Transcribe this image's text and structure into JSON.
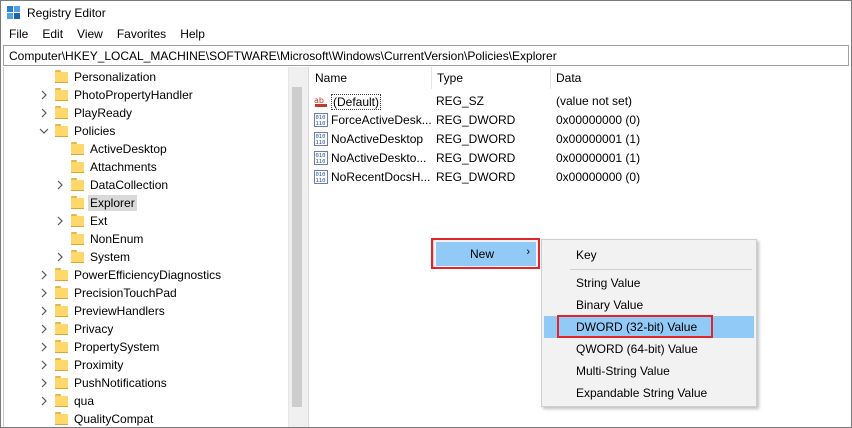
{
  "window": {
    "title": "Registry Editor"
  },
  "menu": [
    "File",
    "Edit",
    "View",
    "Favorites",
    "Help"
  ],
  "address": "Computer\\HKEY_LOCAL_MACHINE\\SOFTWARE\\Microsoft\\Windows\\CurrentVersion\\Policies\\Explorer",
  "tree": {
    "items": [
      {
        "label": "Personalization",
        "level": 1,
        "expander": "none",
        "selected": false
      },
      {
        "label": "PhotoPropertyHandler",
        "level": 1,
        "expander": "collapsed",
        "selected": false
      },
      {
        "label": "PlayReady",
        "level": 1,
        "expander": "collapsed",
        "selected": false
      },
      {
        "label": "Policies",
        "level": 1,
        "expander": "expanded",
        "selected": false
      },
      {
        "label": "ActiveDesktop",
        "level": 2,
        "expander": "none",
        "selected": false
      },
      {
        "label": "Attachments",
        "level": 2,
        "expander": "none",
        "selected": false
      },
      {
        "label": "DataCollection",
        "level": 2,
        "expander": "collapsed",
        "selected": false
      },
      {
        "label": "Explorer",
        "level": 2,
        "expander": "none",
        "selected": true
      },
      {
        "label": "Ext",
        "level": 2,
        "expander": "collapsed",
        "selected": false
      },
      {
        "label": "NonEnum",
        "level": 2,
        "expander": "none",
        "selected": false
      },
      {
        "label": "System",
        "level": 2,
        "expander": "collapsed",
        "selected": false
      },
      {
        "label": "PowerEfficiencyDiagnostics",
        "level": 1,
        "expander": "collapsed",
        "selected": false
      },
      {
        "label": "PrecisionTouchPad",
        "level": 1,
        "expander": "collapsed",
        "selected": false
      },
      {
        "label": "PreviewHandlers",
        "level": 1,
        "expander": "collapsed",
        "selected": false
      },
      {
        "label": "Privacy",
        "level": 1,
        "expander": "collapsed",
        "selected": false
      },
      {
        "label": "PropertySystem",
        "level": 1,
        "expander": "collapsed",
        "selected": false
      },
      {
        "label": "Proximity",
        "level": 1,
        "expander": "collapsed",
        "selected": false
      },
      {
        "label": "PushNotifications",
        "level": 1,
        "expander": "collapsed",
        "selected": false
      },
      {
        "label": "qua",
        "level": 1,
        "expander": "collapsed",
        "selected": false
      },
      {
        "label": "QualityCompat",
        "level": 1,
        "expander": "none",
        "selected": false
      }
    ]
  },
  "values": {
    "headers": {
      "name": "Name",
      "type": "Type",
      "data": "Data"
    },
    "rows": [
      {
        "name": "(Default)",
        "type": "REG_SZ",
        "data": "(value not set)",
        "icon": "string-value-icon"
      },
      {
        "name": "ForceActiveDesk...",
        "type": "REG_DWORD",
        "data": "0x00000000 (0)",
        "icon": "binary-value-icon"
      },
      {
        "name": "NoActiveDesktop",
        "type": "REG_DWORD",
        "data": "0x00000001 (1)",
        "icon": "binary-value-icon"
      },
      {
        "name": "NoActiveDeskto...",
        "type": "REG_DWORD",
        "data": "0x00000001 (1)",
        "icon": "binary-value-icon"
      },
      {
        "name": "NoRecentDocsH...",
        "type": "REG_DWORD",
        "data": "0x00000000 (0)",
        "icon": "binary-value-icon"
      }
    ]
  },
  "context_menu": {
    "new_label": "New",
    "submenu": [
      "Key",
      "String Value",
      "Binary Value",
      "DWORD (32-bit) Value",
      "QWORD (64-bit) Value",
      "Multi-String Value",
      "Expandable String Value"
    ],
    "highlighted": "DWORD (32-bit) Value"
  },
  "colors": {
    "highlight": "#91c9f7",
    "annotation_box": "#e0262b",
    "folder": "#ffd86b"
  }
}
